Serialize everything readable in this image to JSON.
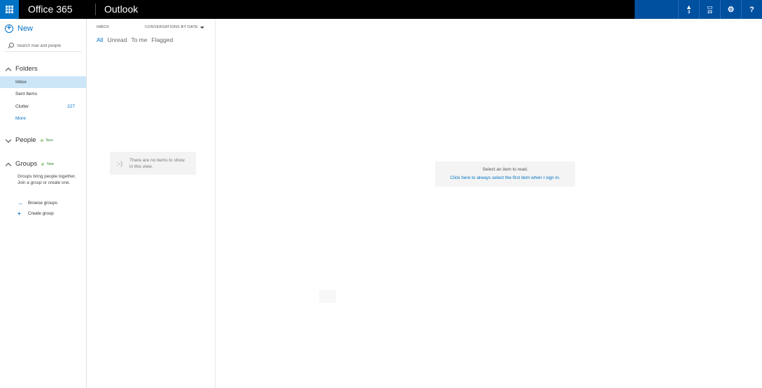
{
  "topbar": {
    "brand": "Office 365",
    "app": "Outlook",
    "notifications": {
      "glyph": "▲",
      "count": "3"
    },
    "calendar": {
      "glyph": "▭",
      "count": "23"
    },
    "settings_glyph": "⚙",
    "help_glyph": "?"
  },
  "leftnav": {
    "new_label": "New",
    "search_placeholder": "Search mail and people",
    "folders_label": "Folders",
    "folders": [
      {
        "name": "Inbox",
        "count": ""
      },
      {
        "name": "Sent Items",
        "count": ""
      },
      {
        "name": "Clutter",
        "count": "227"
      }
    ],
    "more_label": "More",
    "people_label": "People",
    "people_badge": "New",
    "groups_label": "Groups",
    "groups_badge": "New",
    "groups_description": "Groups bring people together. Join a group or create one.",
    "browse_groups": "Browse groups",
    "create_group": "Create group"
  },
  "list": {
    "title": "INBOX",
    "sort_label": "CONVERSATIONS BY DATE",
    "filters": [
      "All",
      "Unread",
      "To me",
      "Flagged"
    ],
    "empty_face": ":-)",
    "empty_message": "There are no items to show in this view."
  },
  "reading": {
    "prompt": "Select an item to read.",
    "link": "Click here to always select the first item when I sign in."
  },
  "colors": {
    "accent": "#0072c6",
    "topbar": "#000000",
    "topbar_right": "#0050a0",
    "selected": "#cde6f7"
  }
}
